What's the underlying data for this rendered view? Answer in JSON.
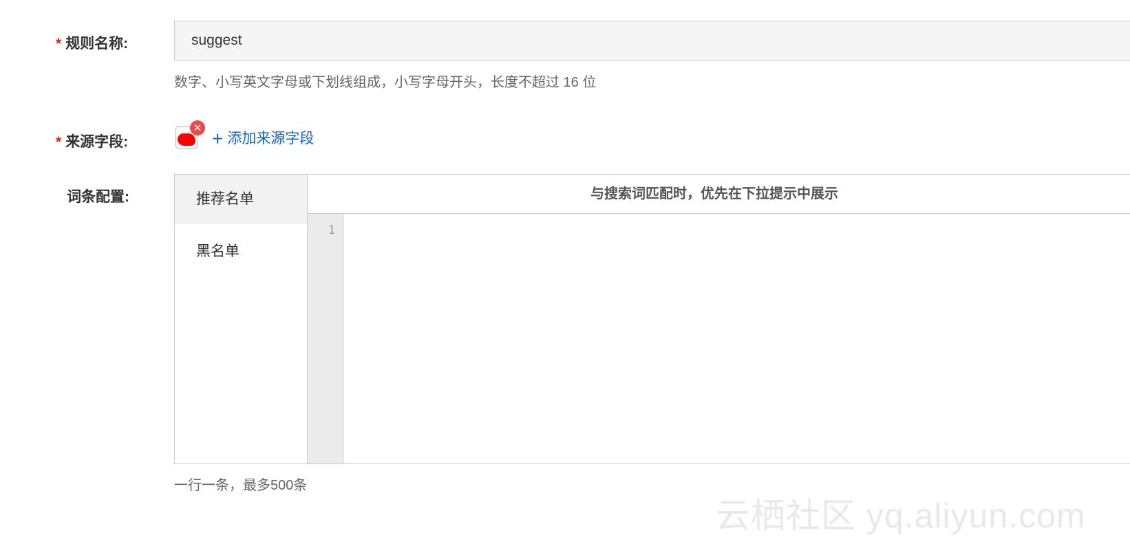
{
  "form": {
    "rule_name": {
      "required_mark": "*",
      "label": "规则名称:",
      "value": "suggest",
      "hint": "数字、小写英文字母或下划线组成，小写字母开头，长度不超过 16 位"
    },
    "source_fields": {
      "required_mark": "*",
      "label": "来源字段:",
      "tag_remove_glyph": "✕",
      "add_icon": "+",
      "add_label": "添加来源字段"
    },
    "entry_config": {
      "label": "词条配置:",
      "tabs": [
        {
          "label": "推荐名单",
          "active": true
        },
        {
          "label": "黑名单",
          "active": false
        }
      ],
      "header": "与搜索词匹配时，优先在下拉提示中展示",
      "line_number": "1",
      "hint": "一行一条，最多500条"
    }
  },
  "watermark": "云栖社区 yq.aliyun.com",
  "colors": {
    "required": "#e02020",
    "link": "#1a63c6",
    "remove_badge": "#f04848",
    "tag_redaction": "#ff0000"
  }
}
